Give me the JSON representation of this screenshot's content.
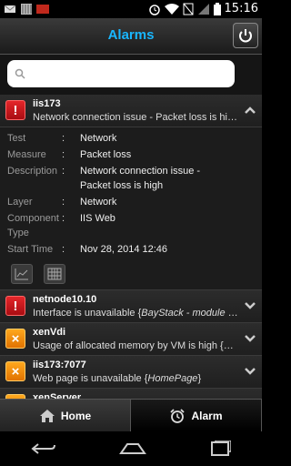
{
  "status_bar": {
    "time": "15:16",
    "icons": [
      "notification-gmail-icon",
      "notification-stripes-icon",
      "notification-app-icon",
      "alarm-clock-icon",
      "wifi-icon",
      "no-sim-icon",
      "signal-icon",
      "battery-icon"
    ]
  },
  "header": {
    "title": "Alarms",
    "power_icon": "power-icon"
  },
  "search": {
    "placeholder": "",
    "value": ""
  },
  "alarms": [
    {
      "host": "iis173",
      "severity": "critical",
      "severity_symbol": "!",
      "description": "Network connection issue - Packet loss is hi…",
      "expanded": true,
      "details": [
        {
          "label": "Test",
          "value": "Network"
        },
        {
          "label": "Measure",
          "value": "Packet loss"
        },
        {
          "label": "Description",
          "value": "Network connection issue - Packet loss is high"
        },
        {
          "label": "Layer",
          "value": "Network"
        },
        {
          "label": "Component Type",
          "value": "IIS Web"
        },
        {
          "label": "Start Time",
          "value": "Nov 28, 2014 12:46"
        }
      ]
    },
    {
      "host": "netnode10.10",
      "severity": "critical",
      "severity_symbol": "!",
      "description": "Interface is unavailable {",
      "description_italic": "BayStack - module 1…"
    },
    {
      "host": "xenVdi",
      "severity": "major",
      "severity_symbol": "×",
      "description": "Usage of allocated memory by VM is high {",
      "description_italic": "xen…"
    },
    {
      "host": "iis173:7077",
      "severity": "major",
      "severity_symbol": "×",
      "description": "Web page is unavailable {",
      "description_italic": "HomePage",
      "description_end": "}"
    },
    {
      "host": "xenServer",
      "severity": "major",
      "severity_symbol": "×",
      "description": ""
    }
  ],
  "tabs": [
    {
      "label": "Home",
      "icon": "home-icon",
      "active": false
    },
    {
      "label": "Alarm",
      "icon": "alarm-clock-icon",
      "active": true
    }
  ],
  "colors": {
    "critical": "#d81c22",
    "major": "#f08a0c",
    "title": "#19b6ff"
  }
}
